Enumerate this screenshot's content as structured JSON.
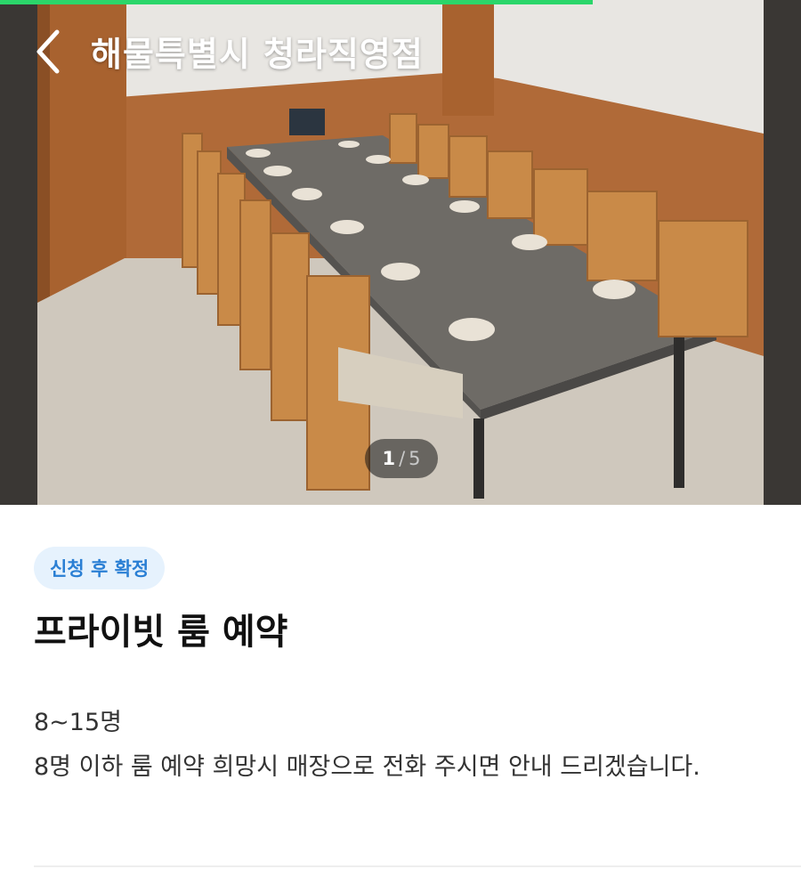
{
  "header": {
    "title": "해물특별시 청라직영점",
    "back_icon": "chevron-left-icon"
  },
  "gallery": {
    "current": "1",
    "separator": "/",
    "total": "5",
    "progress_fraction": 0.74,
    "progress_color": "#2bd66a"
  },
  "room": {
    "badge": "신청 후 확정",
    "name": "프라이빗 룸 예약",
    "capacity": "8~15명",
    "description": "8명 이하 룸 예약 희망시 매장으로 전화 주시면 안내 드리겠습니다."
  },
  "colors": {
    "badge_bg": "#e6f2fd",
    "badge_text": "#2a7fd4"
  }
}
